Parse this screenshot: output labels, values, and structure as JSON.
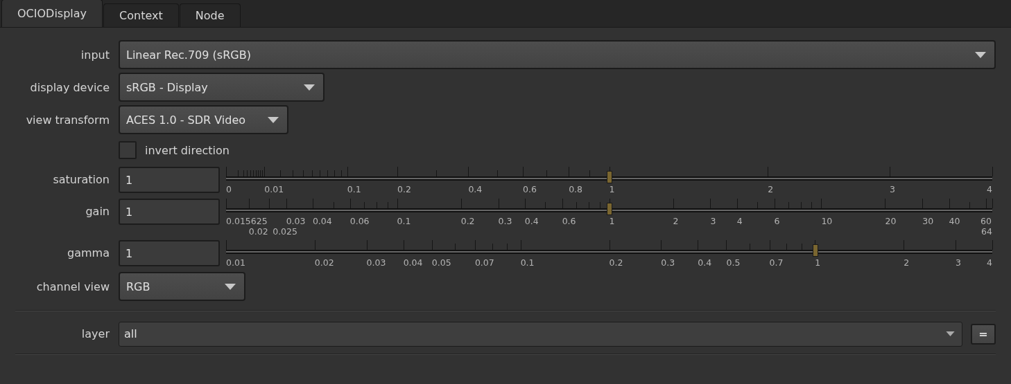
{
  "tabs": [
    {
      "label": "OCIODisplay",
      "selected": true
    },
    {
      "label": "Context",
      "selected": false
    },
    {
      "label": "Node",
      "selected": false
    }
  ],
  "params": [
    {
      "kind": "dropdown",
      "label": "input",
      "value": "Linear Rec.709 (sRGB)"
    },
    {
      "kind": "dropdown",
      "label": "display device",
      "value": "sRGB - Display"
    },
    {
      "kind": "dropdown",
      "label": "view transform",
      "value": "ACES 1.0 - SDR Video"
    },
    {
      "kind": "checkbox",
      "label": "invert direction",
      "checked": false
    },
    {
      "kind": "slider",
      "label": "saturation",
      "value": "1",
      "level": 0.5,
      "ticks": [
        "0",
        "0.01",
        "0.1",
        "0.2",
        "0.4",
        "0.6",
        "0.8",
        "1",
        "2",
        "3",
        "4"
      ]
    },
    {
      "kind": "slider",
      "label": "gain",
      "value": "1",
      "level": 0.5,
      "ticks": [
        "0.015625",
        "0.02",
        "0.025",
        "0.03",
        "0.04",
        "0.06",
        "0.1",
        "0.2",
        "0.3",
        "0.4",
        "0.6",
        "1",
        "2",
        "3",
        "4",
        "6",
        "10",
        "20",
        "30",
        "40",
        "60",
        "64"
      ]
    },
    {
      "kind": "slider",
      "label": "gamma",
      "value": "1",
      "level": 0.769,
      "ticks": [
        "0.01",
        "0.02",
        "0.03",
        "0.04",
        "0.05",
        "0.07",
        "0.1",
        "0.2",
        "0.3",
        "0.4",
        "0.5",
        "0.7",
        "1",
        "2",
        "3",
        "4"
      ]
    },
    {
      "kind": "dropdown",
      "label": "channel view",
      "value": "RGB"
    }
  ],
  "layer": {
    "label": "layer",
    "value": "all",
    "button": "="
  }
}
